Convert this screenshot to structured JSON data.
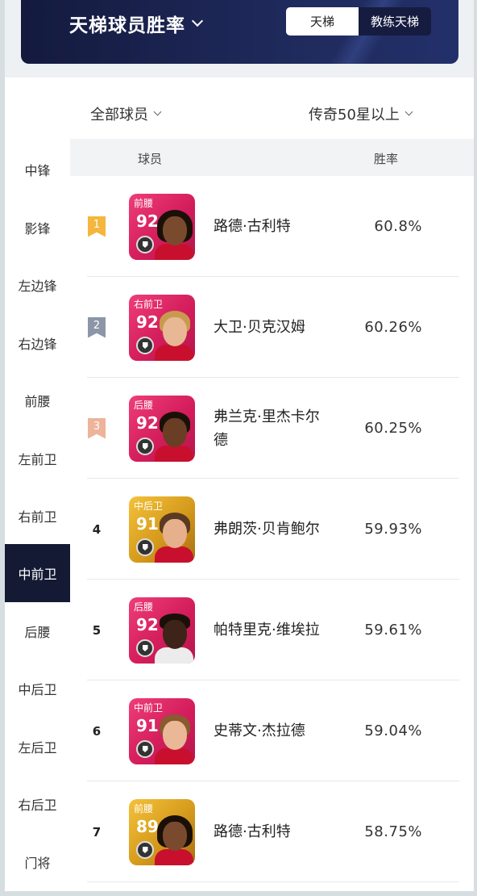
{
  "header": {
    "title": "天梯球员胜率",
    "tabs": [
      {
        "label": "天梯",
        "active": true
      },
      {
        "label": "教练天梯",
        "active": false
      }
    ]
  },
  "filters": {
    "players": "全部球员",
    "level": "传奇50星以上"
  },
  "sidebar": {
    "items": [
      {
        "label": "中锋",
        "active": false
      },
      {
        "label": "影锋",
        "active": false
      },
      {
        "label": "左边锋",
        "active": false
      },
      {
        "label": "右边锋",
        "active": false
      },
      {
        "label": "前腰",
        "active": false
      },
      {
        "label": "左前卫",
        "active": false
      },
      {
        "label": "右前卫",
        "active": false
      },
      {
        "label": "中前卫",
        "active": true
      },
      {
        "label": "后腰",
        "active": false
      },
      {
        "label": "中后卫",
        "active": false
      },
      {
        "label": "左后卫",
        "active": false
      },
      {
        "label": "右后卫",
        "active": false
      },
      {
        "label": "门将",
        "active": false
      }
    ]
  },
  "table": {
    "columns": [
      "球员",
      "胜率"
    ],
    "rows": [
      {
        "rank": "1",
        "position": "前腰",
        "rating": "92",
        "card": "pink",
        "name": "路德·古利特",
        "rate": "60.8%"
      },
      {
        "rank": "2",
        "position": "右前卫",
        "rating": "92",
        "card": "pink",
        "name": "大卫·贝克汉姆",
        "rate": "60.26%"
      },
      {
        "rank": "3",
        "position": "后腰",
        "rating": "92",
        "card": "pink",
        "name": "弗兰克·里杰卡尔德",
        "rate": "60.25%"
      },
      {
        "rank": "4",
        "position": "中后卫",
        "rating": "91",
        "card": "gold",
        "name": "弗朗茨·贝肯鲍尔",
        "rate": "59.93%"
      },
      {
        "rank": "5",
        "position": "后腰",
        "rating": "92",
        "card": "pink",
        "name": "帕特里克·维埃拉",
        "rate": "59.61%"
      },
      {
        "rank": "6",
        "position": "中前卫",
        "rating": "91",
        "card": "pink",
        "name": "史蒂文·杰拉德",
        "rate": "59.04%"
      },
      {
        "rank": "7",
        "position": "前腰",
        "rating": "89",
        "card": "gold",
        "name": "路德·古利特",
        "rate": "58.75%"
      }
    ]
  },
  "colors": {
    "rank1": "#f5b63e",
    "rank2": "#8d96a8",
    "rank3": "#eeb39b",
    "banner": "#1a2150",
    "active_sidebar": "#141a33"
  }
}
